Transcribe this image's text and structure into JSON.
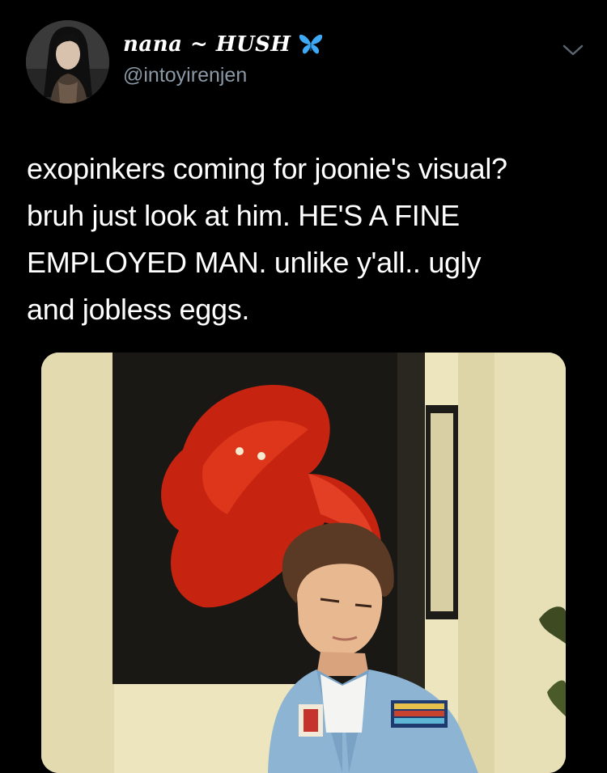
{
  "header": {
    "display_name": "nana ~ HUSH",
    "handle": "@intoyirenjen",
    "name_icon": "butterfly-icon",
    "menu_icon": "chevron-down-icon"
  },
  "tweet": {
    "lines": [
      "exopinkers coming for joonie's visual?",
      "bruh just look at him. HE'S A FINE",
      "EMPLOYED MAN. unlike y'all.. ugly",
      "and jobless eggs."
    ]
  },
  "colors": {
    "background": "#000000",
    "text": "#ffffff",
    "handle": "#8b98a5",
    "butterfly": "#3fa9f5",
    "fish": "#d42a14"
  }
}
